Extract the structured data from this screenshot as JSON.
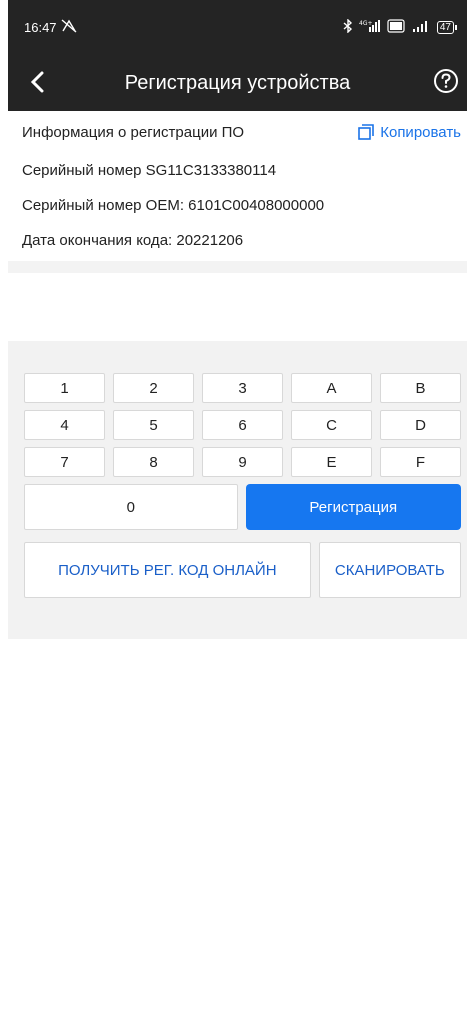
{
  "status_bar": {
    "time": "16:47",
    "battery": "47",
    "icons": [
      "signal-off-icon",
      "bluetooth-icon",
      "network-4g-icon",
      "volte-icon",
      "signal-icon",
      "battery-icon"
    ]
  },
  "header": {
    "title": "Регистрация устройства",
    "back_icon": "chevron-left-icon",
    "help_icon": "question-circle-icon"
  },
  "info": {
    "heading": "Информация о регистрации ПО",
    "copy_label": "Копировать",
    "serial": "Серийный номер  SG11C3133380114",
    "oem_serial": "Серийный номер OEM:  6101C00408000000",
    "expiry": "Дата окончания кода:  20221206"
  },
  "keypad": {
    "rows": [
      [
        "1",
        "2",
        "3",
        "A",
        "B"
      ],
      [
        "4",
        "5",
        "6",
        "C",
        "D"
      ],
      [
        "7",
        "8",
        "9",
        "E",
        "F"
      ]
    ],
    "zero": "0",
    "register": "Регистрация"
  },
  "actions": {
    "online": "ПОЛУЧИТЬ РЕГ. КОД ОНЛАЙН",
    "scan": "СКАНИРОВАТЬ"
  },
  "colors": {
    "header_bg": "#242424",
    "accent": "#1677f0",
    "link": "#1a73e8",
    "panel_bg": "#f2f2f2"
  }
}
